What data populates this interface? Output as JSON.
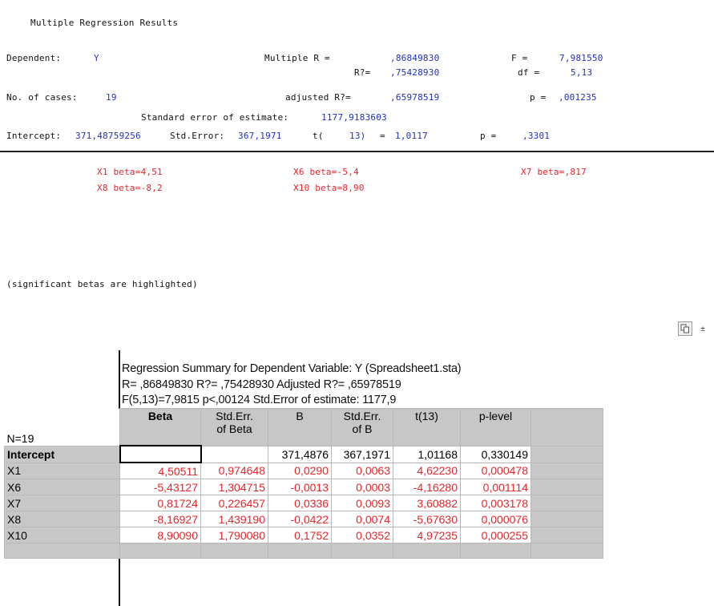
{
  "report": {
    "title": "Multiple Regression Results",
    "dependent_label": "Dependent:",
    "dependent_value": "Y",
    "multiple_r_label": "Multiple R =",
    "multiple_r_value": ",86849830",
    "f_label": "F =",
    "f_value": "7,981550",
    "r2_label": "R?=",
    "r2_value": ",75428930",
    "df_label": "df =",
    "df_value": "5,13",
    "cases_label": "No. of cases:",
    "cases_value": "19",
    "adj_r2_label": "adjusted R?=",
    "adj_r2_value": ",65978519",
    "p_label": "p =",
    "p_value": ",001235",
    "std_err_est_label": "Standard error of estimate:",
    "std_err_est_value": "1177,9183603",
    "intercept_label": "Intercept:",
    "intercept_value": "371,48759256",
    "intercept_stderr_label": "Std.Error:",
    "intercept_stderr_value": "367,1971",
    "intercept_t_label": "t(",
    "intercept_t_df": "13)",
    "intercept_t_eq": "=",
    "intercept_t_value": "1,0117",
    "intercept_p_label": "p =",
    "intercept_p_value": ",3301",
    "betas": [
      {
        "text": "X1 beta=4,51"
      },
      {
        "text": "X6 beta=-5,4"
      },
      {
        "text": "X7 beta=,817"
      },
      {
        "text": "X8 beta=-8,2"
      },
      {
        "text": "X10 beta=8,90"
      }
    ],
    "note": "(significant betas are highlighted)"
  },
  "toolbar": {
    "copy_icon": "copy-icon",
    "pin_icon": "pin-icon",
    "pin_glyph": "±"
  },
  "summary": {
    "line1": "Regression Summary for Dependent Variable: Y (Spreadsheet1.sta)",
    "line2": "R= ,86849830 R?= ,75428930 Adjusted R?= ,65978519",
    "line3": "F(5,13)=7,9815 p<,00124 Std.Error of estimate: 1177,9"
  },
  "table": {
    "corner": "N=19",
    "headers": [
      {
        "line1": "Beta",
        "line2": ""
      },
      {
        "line1": "Std.Err.",
        "line2": "of Beta"
      },
      {
        "line1": "B",
        "line2": ""
      },
      {
        "line1": "Std.Err.",
        "line2": "of B"
      },
      {
        "line1": "t(13)",
        "line2": ""
      },
      {
        "line1": "p-level",
        "line2": ""
      }
    ],
    "rows": [
      {
        "label": "Intercept",
        "cells": [
          "",
          "",
          "371,4876",
          "367,1971",
          "1,01168",
          "0,330149"
        ]
      },
      {
        "label": "X1",
        "cells": [
          "4,50511",
          "0,974648",
          "0,0290",
          "0,0063",
          "4,62230",
          "0,000478"
        ]
      },
      {
        "label": "X6",
        "cells": [
          "-5,43127",
          "1,304715",
          "-0,0013",
          "0,0003",
          "-4,16280",
          "0,001114"
        ]
      },
      {
        "label": "X7",
        "cells": [
          "0,81724",
          "0,226457",
          "0,0336",
          "0,0093",
          "3,60882",
          "0,003178"
        ]
      },
      {
        "label": "X8",
        "cells": [
          "-8,16927",
          "1,439190",
          "-0,0422",
          "0,0074",
          "-5,67630",
          "0,000076"
        ]
      },
      {
        "label": "X10",
        "cells": [
          "8,90090",
          "1,790080",
          "0,1752",
          "0,0352",
          "4,97235",
          "0,000255"
        ]
      }
    ]
  },
  "colors": {
    "highlight": "#e5262a",
    "value_blue": "#2130c0",
    "grid_header": "#c7c7c7"
  }
}
